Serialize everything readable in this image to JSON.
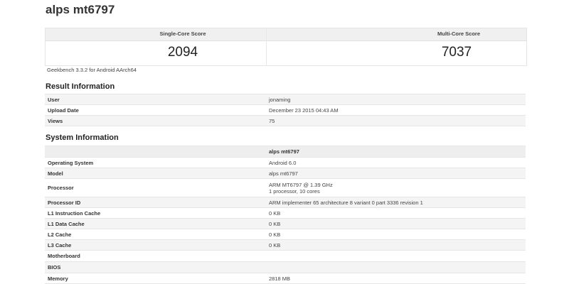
{
  "page": {
    "title": "alps mt6797"
  },
  "scores": {
    "single_label": "Single-Core Score",
    "single_value": "2094",
    "multi_label": "Multi-Core Score",
    "multi_value": "7037"
  },
  "benchmark_version": "Geekbench 3.3.2 for Android AArch64",
  "result_info": {
    "title": "Result Information",
    "rows": [
      {
        "label": "User",
        "value": "jonaming"
      },
      {
        "label": "Upload Date",
        "value": "December 23 2015 04:43 AM"
      },
      {
        "label": "Views",
        "value": "75"
      }
    ]
  },
  "system_info": {
    "title": "System Information",
    "header": "alps mt6797",
    "rows": [
      {
        "label": "Operating System",
        "value": "Android 6.0"
      },
      {
        "label": "Model",
        "value": "alps mt6797"
      },
      {
        "label": "Processor",
        "value": "ARM MT6797 @ 1.39 GHz",
        "value2": "1 processor, 10 cores"
      },
      {
        "label": "Processor ID",
        "value": "ARM implementer 65 architecture 8 variant 0 part 3336 revision 1"
      },
      {
        "label": "L1 Instruction Cache",
        "value": "0 KB"
      },
      {
        "label": "L1 Data Cache",
        "value": "0 KB"
      },
      {
        "label": "L2 Cache",
        "value": "0 KB"
      },
      {
        "label": "L3 Cache",
        "value": "0 KB"
      },
      {
        "label": "Motherboard",
        "value": ""
      },
      {
        "label": "BIOS",
        "value": ""
      },
      {
        "label": "Memory",
        "value": "2818 MB"
      }
    ]
  },
  "colors": {
    "link": "#3b6fb6",
    "row_shade": "#f4f4f4",
    "header_shade": "#f0f0f0"
  }
}
